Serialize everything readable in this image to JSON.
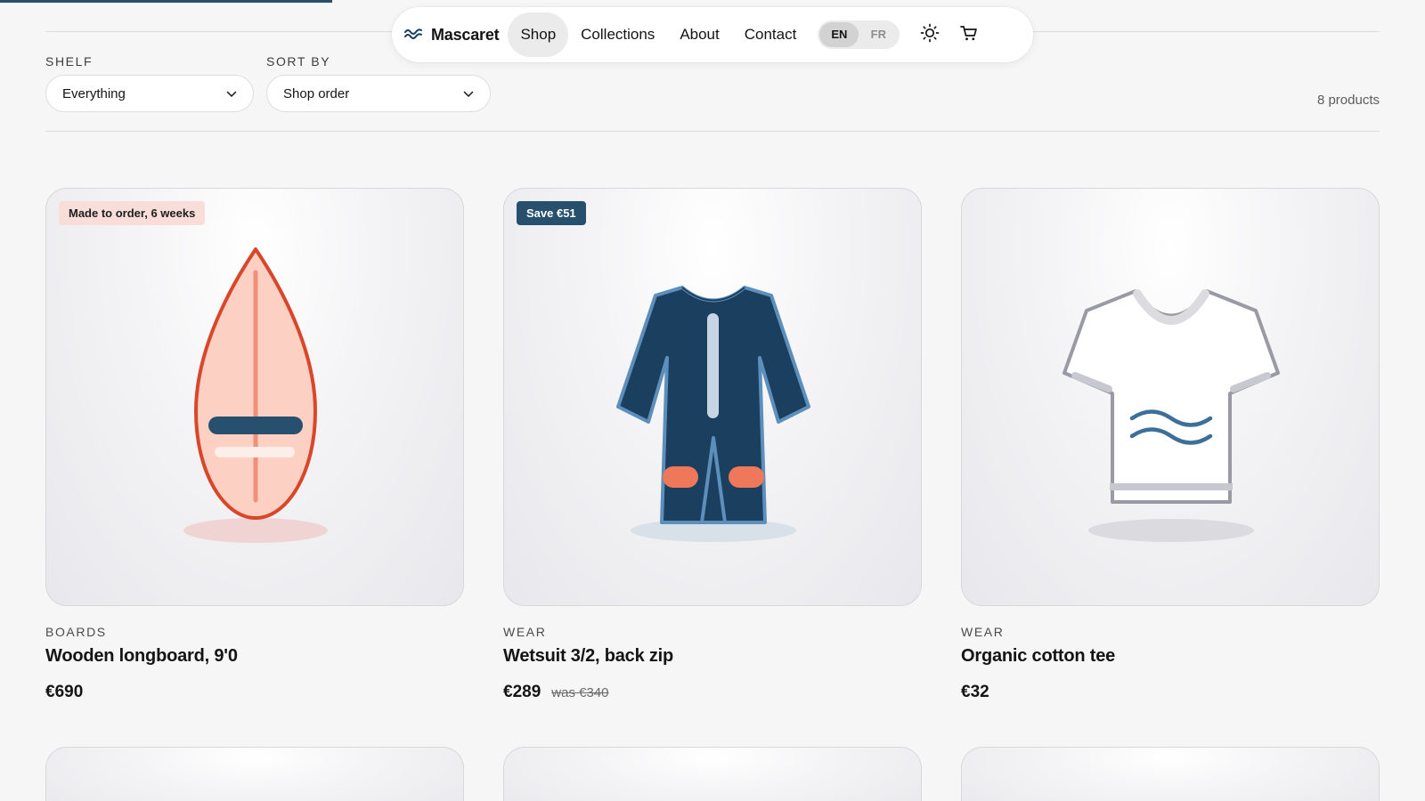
{
  "brand": {
    "name": "Mascaret"
  },
  "nav": {
    "links": [
      "Shop",
      "Collections",
      "About",
      "Contact"
    ],
    "active": "Shop",
    "languages": [
      "EN",
      "FR"
    ],
    "active_language": "EN"
  },
  "filters": {
    "shelf_label": "SHELF",
    "shelf_value": "Everything",
    "sort_label": "SORT BY",
    "sort_value": "Shop order"
  },
  "count_text": "8 products",
  "products": [
    {
      "badge": "Made to order, 6 weeks",
      "badge_style": "light",
      "category": "BOARDS",
      "title": "Wooden longboard, 9'0",
      "price": "€690",
      "was": "",
      "icon": "surfboard-icon"
    },
    {
      "badge": "Save €51",
      "badge_style": "dark",
      "category": "WEAR",
      "title": "Wetsuit 3/2, back zip",
      "price": "€289",
      "was": "was €340",
      "icon": "wetsuit-icon"
    },
    {
      "badge": "",
      "badge_style": "",
      "category": "WEAR",
      "title": "Organic cotton tee",
      "price": "€32",
      "was": "",
      "icon": "tshirt-icon"
    }
  ],
  "colors": {
    "accent": "#27506f",
    "board_fill": "#fdd0c4",
    "board_stroke": "#d9472a",
    "wetsuit_navy": "#1b3f5e",
    "knee_pad": "#f0785a"
  }
}
